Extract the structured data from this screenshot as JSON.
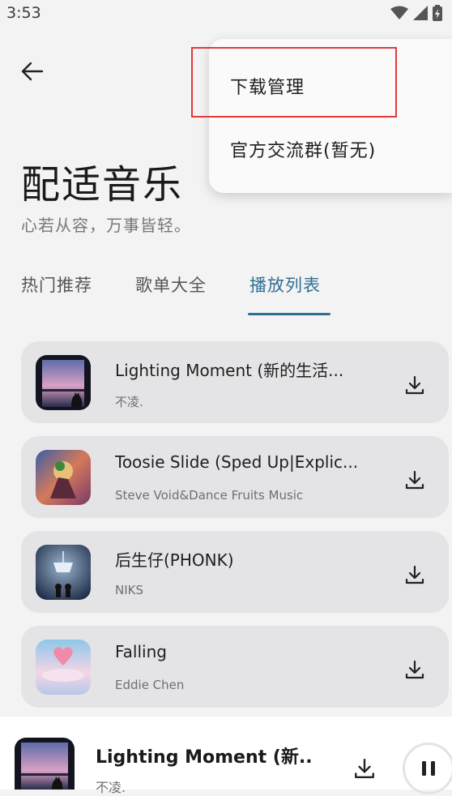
{
  "status": {
    "time": "3:53"
  },
  "header": {
    "title": "配适音乐",
    "subtitle": "心若从容，万事皆轻。"
  },
  "tabs": [
    {
      "label": "热门推荐"
    },
    {
      "label": "歌单大全"
    },
    {
      "label": "播放列表"
    }
  ],
  "active_tab": "播放列表",
  "songs": [
    {
      "title": "Lighting Moment (新的生活...",
      "artist": "不凌."
    },
    {
      "title": "Toosie Slide (Sped Up|Explic...",
      "artist": "Steve Void&Dance Fruits Music"
    },
    {
      "title": "后生仔(PHONK)",
      "artist": "NIKS"
    },
    {
      "title": "Falling",
      "artist": "Eddie Chen"
    }
  ],
  "menu": {
    "items": [
      {
        "label": "下载管理"
      },
      {
        "label": "官方交流群(暂无)"
      }
    ]
  },
  "player": {
    "title": "Lighting Moment (新...",
    "artist": "不凌."
  },
  "colors": {
    "accent": "#2f6f95",
    "highlight": "#e23a3a",
    "card_bg": "#e4e4e6"
  }
}
